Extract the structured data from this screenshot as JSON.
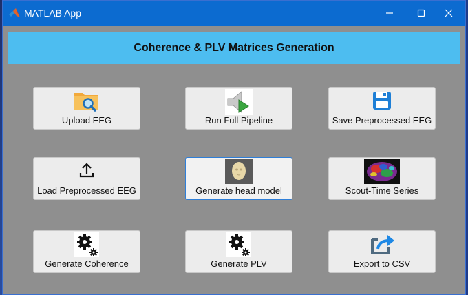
{
  "window": {
    "title": "MATLAB App"
  },
  "header": {
    "title": "Coherence & PLV Matrices Generation"
  },
  "buttons": [
    {
      "label": "Upload EEG",
      "icon": "folder-search-icon"
    },
    {
      "label": "Run Full Pipeline",
      "icon": "speaker-play-icon"
    },
    {
      "label": "Save Preprocessed EEG",
      "icon": "floppy-disk-icon"
    },
    {
      "label": "Load Preprocessed EEG",
      "icon": "upload-icon"
    },
    {
      "label": "Generate head model",
      "icon": "head-model-icon"
    },
    {
      "label": "Scout-Time Series",
      "icon": "brain-map-icon"
    },
    {
      "label": "Generate Coherence",
      "icon": "gears-icon"
    },
    {
      "label": "Generate PLV",
      "icon": "gears-icon"
    },
    {
      "label": "Export to CSV",
      "icon": "export-icon"
    }
  ],
  "colors": {
    "titlebar": "#0c6bd0",
    "header": "#4dbdf0",
    "background": "#8f8f8f",
    "button": "#ececec"
  }
}
